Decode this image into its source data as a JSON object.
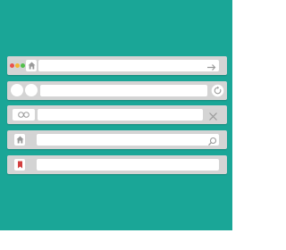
{
  "colors": {
    "background": "#1aa697",
    "bar": "#d4d4d4",
    "field": "#ffffff",
    "icon": "#9a9a9a",
    "traffic_red": "#e9524c",
    "traffic_yellow": "#f2b632",
    "traffic_green": "#52c04b",
    "bookmark": "#d33f3f"
  },
  "bars": [
    {
      "variant": "traffic-lights-home",
      "address_value": "",
      "end_icon": "arrow-right-icon"
    },
    {
      "variant": "two-circles",
      "address_value": "",
      "end_icon": "refresh-icon"
    },
    {
      "variant": "infinity",
      "address_value": "",
      "end_icon": "close-icon"
    },
    {
      "variant": "home",
      "address_value": "",
      "end_icon": "search-icon"
    },
    {
      "variant": "bookmark",
      "address_value": "",
      "end_icon": ""
    }
  ]
}
